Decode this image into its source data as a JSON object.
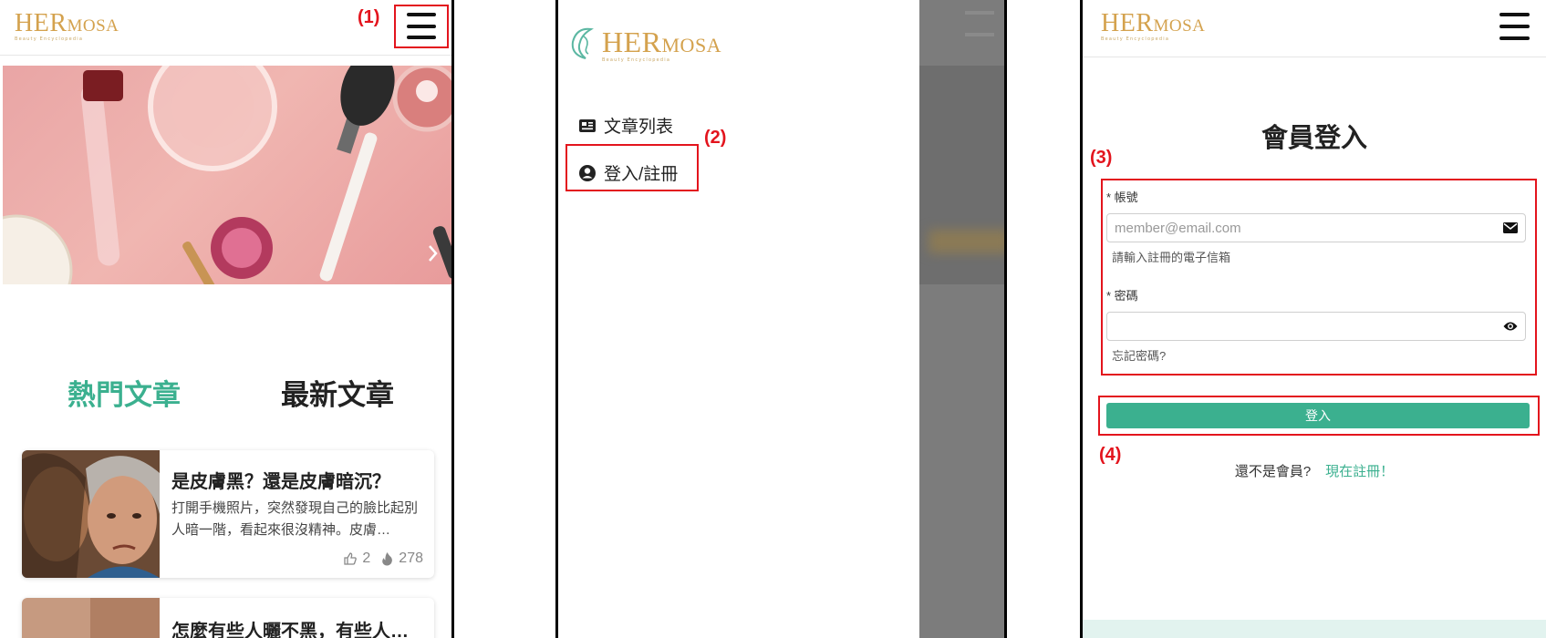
{
  "annotations": {
    "step1": "(1)",
    "step2": "(2)",
    "step3": "(3)",
    "step4": "(4)"
  },
  "brand": {
    "logo_her": "HER",
    "logo_mosa": "MOSA",
    "logo_sub": "Beauty Encyclopedia",
    "accent_color": "#3bb08f",
    "logo_color": "#d4a24e",
    "annotation_color": "#e3141d"
  },
  "panel1": {
    "tabs": {
      "hot": "熱門文章",
      "latest": "最新文章"
    },
    "articles": [
      {
        "title": "是皮膚黑？還是皮膚暗沉？",
        "excerpt": "打開手機照片，突然發現自己的臉比起別人暗一階，看起來很沒精神。皮膚…",
        "likes": "2",
        "views": "278"
      },
      {
        "title": "怎麼有些人曬不黑，有些人…",
        "excerpt": "",
        "likes": "",
        "views": ""
      }
    ]
  },
  "panel2": {
    "menu": {
      "articles_label": "文章列表",
      "login_label": "登入/註冊"
    }
  },
  "panel3": {
    "title": "會員登入",
    "account": {
      "label": "* 帳號",
      "placeholder": "member@email.com",
      "hint": "請輸入註冊的電子信箱"
    },
    "password": {
      "label": "* 密碼",
      "forgot": "忘記密碼?"
    },
    "login_button": "登入",
    "not_member": "還不是會員?",
    "register_link": "現在註冊！"
  }
}
